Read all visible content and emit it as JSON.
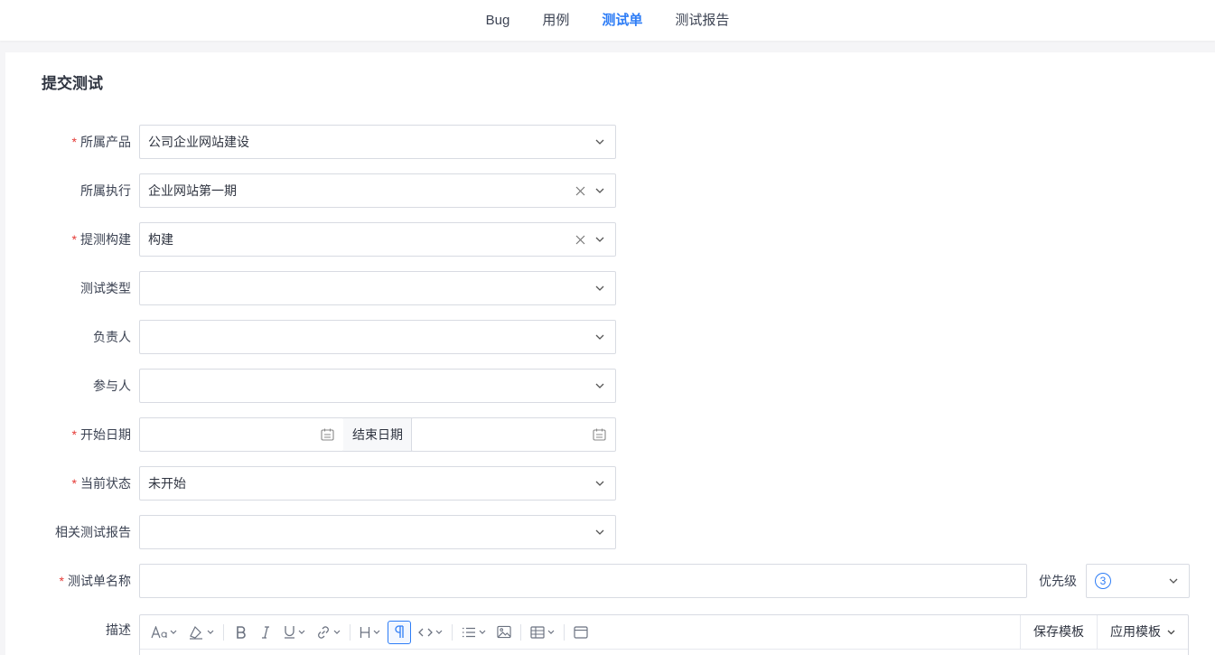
{
  "nav": {
    "items": [
      {
        "label": "Bug"
      },
      {
        "label": "用例"
      },
      {
        "label": "测试单"
      },
      {
        "label": "测试报告"
      }
    ],
    "active": "测试单"
  },
  "page": {
    "title": "提交测试"
  },
  "form": {
    "product": {
      "label": "所属产品",
      "required": true,
      "value": "公司企业网站建设"
    },
    "execution": {
      "label": "所属执行",
      "required": false,
      "value": "企业网站第一期"
    },
    "build": {
      "label": "提测构建",
      "required": true,
      "value": "构建"
    },
    "test_type": {
      "label": "测试类型",
      "required": false,
      "value": ""
    },
    "owner": {
      "label": "负责人",
      "required": false,
      "value": ""
    },
    "participants": {
      "label": "参与人",
      "required": false,
      "value": ""
    },
    "start_date": {
      "label": "开始日期",
      "required": true,
      "value": ""
    },
    "end_date": {
      "label": "结束日期",
      "value": ""
    },
    "status": {
      "label": "当前状态",
      "required": true,
      "value": "未开始"
    },
    "related_report": {
      "label": "相关测试报告",
      "required": false,
      "value": ""
    },
    "name": {
      "label": "测试单名称",
      "required": true,
      "value": ""
    },
    "priority": {
      "label": "优先级",
      "value": "3"
    },
    "description": {
      "label": "描述"
    }
  },
  "editor": {
    "save_template": "保存模板",
    "apply_template": "应用模板"
  },
  "required_mark": "*"
}
